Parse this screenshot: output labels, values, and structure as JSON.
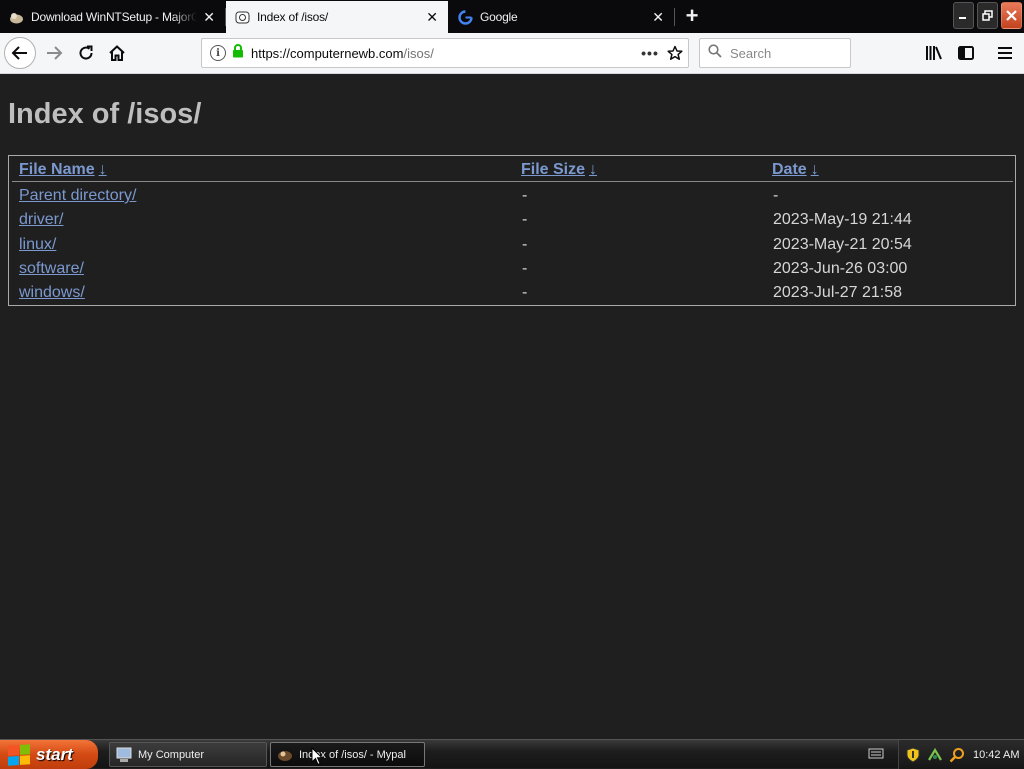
{
  "browser": {
    "tabs": [
      {
        "title": "Download WinNTSetup - MajorGee",
        "active": false
      },
      {
        "title": "Index of /isos/",
        "active": true
      },
      {
        "title": "Google",
        "active": false
      }
    ],
    "url": {
      "host": "https://computernewb.com",
      "path": "/isos/"
    },
    "search": {
      "placeholder": "Search"
    },
    "accent": "#12bc00"
  },
  "page": {
    "heading": "Index of /isos/",
    "columns": [
      {
        "label": "File Name",
        "sort_arrow": "↓"
      },
      {
        "label": "File Size",
        "sort_arrow": "↓"
      },
      {
        "label": "Date",
        "sort_arrow": "↓"
      }
    ],
    "rows": [
      {
        "name": "Parent directory/",
        "size": "-",
        "date": "-"
      },
      {
        "name": "driver/",
        "size": "-",
        "date": "2023-May-19 21:44"
      },
      {
        "name": "linux/",
        "size": "-",
        "date": "2023-May-21 20:54"
      },
      {
        "name": "software/",
        "size": "-",
        "date": "2023-Jun-26 03:00"
      },
      {
        "name": "windows/",
        "size": "-",
        "date": "2023-Jul-27 21:58"
      }
    ],
    "link_color": "#7b99cf"
  },
  "taskbar": {
    "start_label": "start",
    "tasks": [
      {
        "label": "My Computer",
        "icon": "my-computer-icon"
      },
      {
        "label": "Index of /isos/ - Mypal",
        "icon": "mypal-icon"
      }
    ],
    "clock": "10:42 AM"
  }
}
